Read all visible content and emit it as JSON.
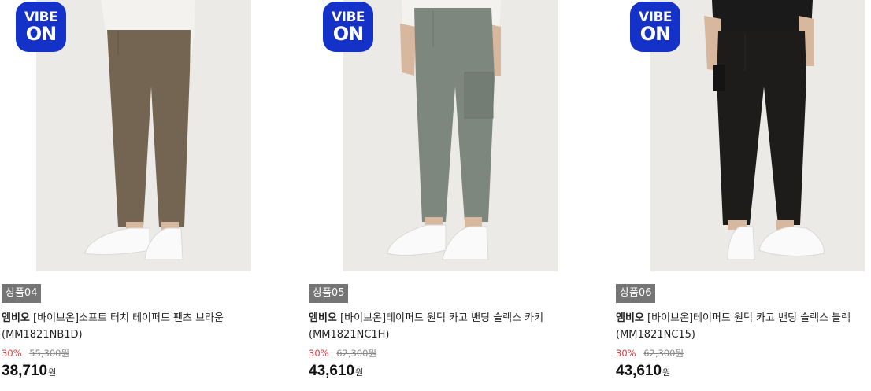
{
  "badge": {
    "line1": "VIBE",
    "line2": "ON"
  },
  "products": [
    {
      "tag": "상품04",
      "brand": "엠비오",
      "title": "[바이브온]소프트 터치 테이퍼드 팬츠 브라운",
      "model": "(MM1821NB1D)",
      "discount": "30%",
      "original_price": "55,300원",
      "price": "38,710",
      "currency": "원",
      "pants_color": "#736552",
      "top_color": "#f4f2ee"
    },
    {
      "tag": "상품05",
      "brand": "엠비오",
      "title": "[바이브온]테이퍼드 원턱 카고 밴딩 슬랙스 카키",
      "model": "(MM1821NC1H)",
      "discount": "30%",
      "original_price": "62,300원",
      "price": "43,610",
      "currency": "원",
      "pants_color": "#7e877d",
      "top_color": "#f4f2ee"
    },
    {
      "tag": "상품06",
      "brand": "엠비오",
      "title": "[바이브온]테이퍼드 원턱 카고 밴딩 슬랙스 블랙",
      "model": "(MM1821NC15)",
      "discount": "30%",
      "original_price": "62,300원",
      "price": "43,610",
      "currency": "원",
      "pants_color": "#1d1c1b",
      "top_color": "#1a1a1a"
    }
  ]
}
